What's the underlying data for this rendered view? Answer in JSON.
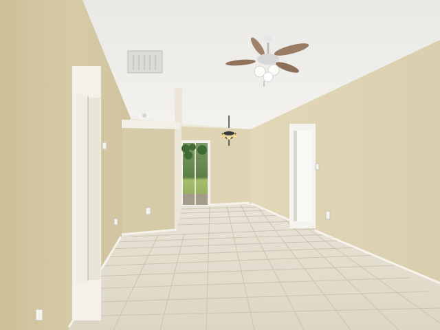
{
  "scene": {
    "kind": "photo",
    "subject": "empty-room-interior",
    "elements": [
      "textured-ceiling",
      "ceiling-fan",
      "chandelier",
      "ceiling-vent",
      "interior-doors",
      "sliding-glass-door",
      "tile-floor",
      "baseboards",
      "outlets",
      "light-switch"
    ],
    "ceiling_fan_lights": 3,
    "colors": {
      "wall": "#d8cfb0",
      "wall_shadow": "#bcb295",
      "ceiling": "#f0efeb",
      "floor_tile": "#e2dccd",
      "grout": "#c7bfac",
      "trim": "#f7f6f1",
      "garden_green": "#8faf5a"
    }
  }
}
